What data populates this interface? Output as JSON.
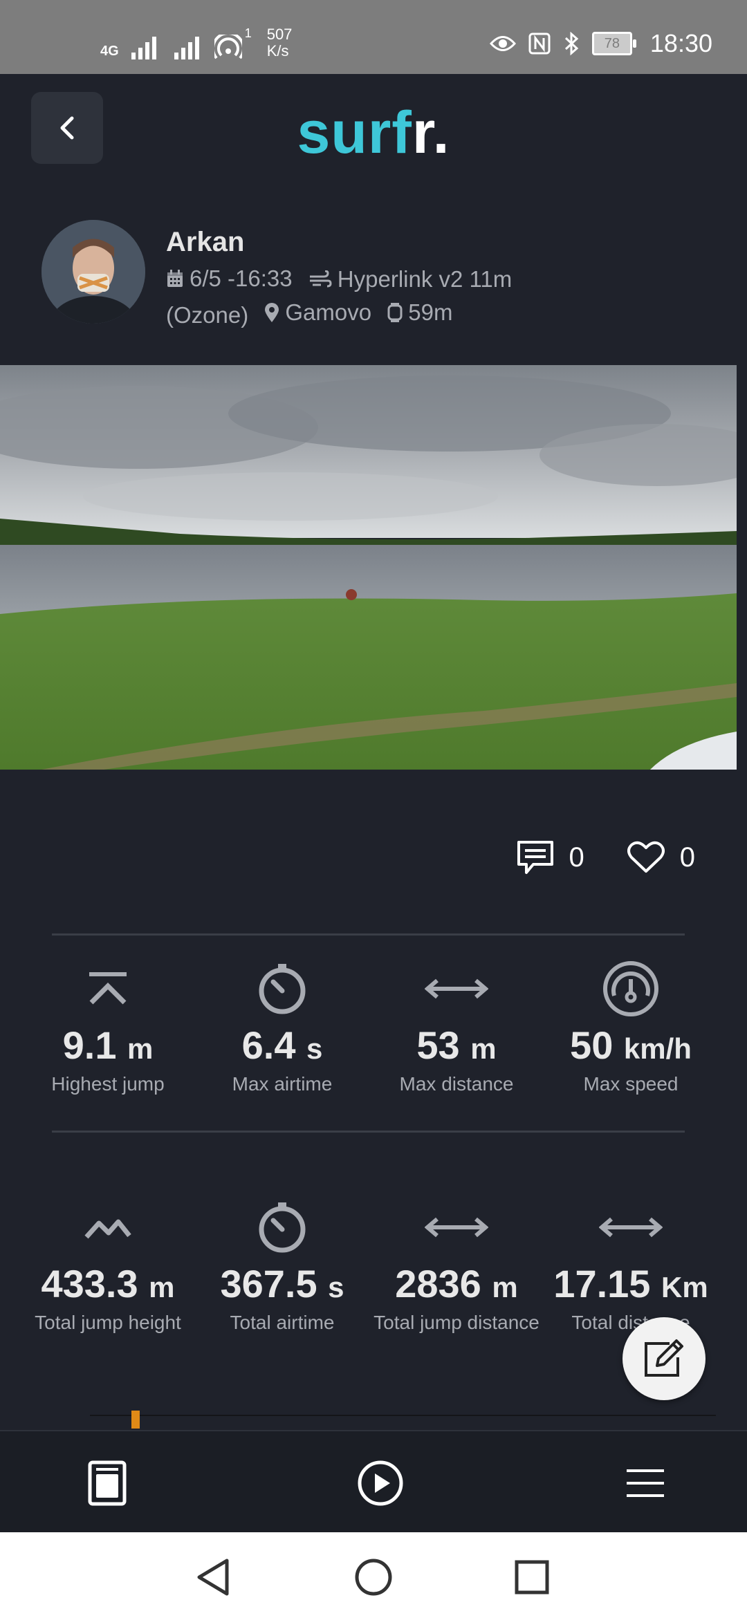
{
  "status_bar": {
    "network": "4G",
    "hotspot_count": "1",
    "net_speed_value": "507",
    "net_speed_unit": "K/s",
    "battery": "78",
    "time": "18:30"
  },
  "header": {
    "logo_main": "surf",
    "logo_accent": "r."
  },
  "session": {
    "user_name": "Arkan",
    "date": "6/5 -16:33",
    "kite": "Hyperlink v2 11m",
    "brand": "(Ozone)",
    "location": "Gamovo",
    "duration": "59m"
  },
  "social": {
    "comments": "0",
    "likes": "0"
  },
  "stats_top": [
    {
      "value": "9.1",
      "unit": "m",
      "label": "Highest jump",
      "icon": "jump-height-icon"
    },
    {
      "value": "6.4",
      "unit": "s",
      "label": "Max airtime",
      "icon": "stopwatch-icon"
    },
    {
      "value": "53",
      "unit": "m",
      "label": "Max distance",
      "icon": "distance-arrows-icon"
    },
    {
      "value": "50",
      "unit": "km/h",
      "label": "Max speed",
      "icon": "speedometer-icon"
    }
  ],
  "stats_bottom": [
    {
      "value": "433.3",
      "unit": "m",
      "label": "Total jump height",
      "icon": "jumps-peaks-icon"
    },
    {
      "value": "367.5",
      "unit": "s",
      "label": "Total airtime",
      "icon": "stopwatch-icon"
    },
    {
      "value": "2836",
      "unit": "m",
      "label": "Total jump distance",
      "icon": "distance-arrows-icon"
    },
    {
      "value": "17.15",
      "unit": "Km",
      "label": "Total distance",
      "icon": "distance-arrows-icon"
    }
  ],
  "colors": {
    "background": "#1f222b",
    "logo_accent": "#3ec7d8",
    "progress_marker": "#e08a17"
  }
}
